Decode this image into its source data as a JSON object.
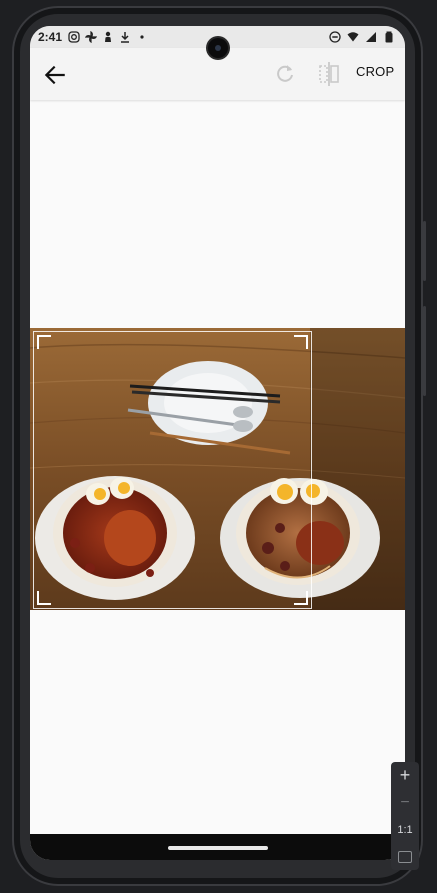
{
  "status_bar": {
    "time": "2:41",
    "left_icons": [
      "instagram-icon",
      "pinwheel-icon",
      "person-icon",
      "download-icon",
      "dot-icon"
    ],
    "right_icons": [
      "do-not-disturb-icon",
      "wifi-icon",
      "signal-icon",
      "battery-icon"
    ]
  },
  "toolbar": {
    "back_icon": "arrow-back-icon",
    "rotate_icon": "rotate-icon",
    "flip_icon": "flip-icon",
    "crop_label": "CROP"
  },
  "editor": {
    "image": "food-photo-two-bowls-of-noodles"
  },
  "emulator_controls": {
    "zoom_in": "+",
    "zoom_out": "−",
    "ratio": "1:1",
    "fit_icon": "fit-screen-icon"
  },
  "colors": {
    "toolbar_bg": "#f4f4f4",
    "status_bg": "#e9e9e9",
    "screen_bg": "#fafafa",
    "frame": "#2b2c2f"
  }
}
